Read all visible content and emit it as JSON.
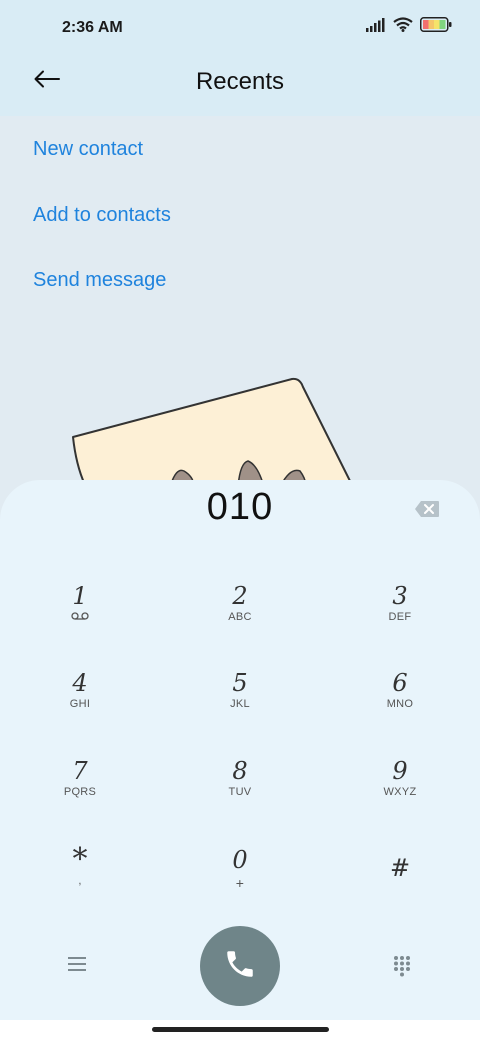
{
  "status_bar": {
    "time": "2:36 AM",
    "icons": [
      "signal-icon",
      "wifi-icon",
      "battery-icon"
    ]
  },
  "header": {
    "back_icon": "back-arrow-icon",
    "title": "Recents"
  },
  "actions": [
    {
      "label": "New contact"
    },
    {
      "label": "Add to contacts"
    },
    {
      "label": "Send message"
    }
  ],
  "dialer": {
    "number": "010",
    "backspace_icon": "backspace-icon",
    "keys": [
      {
        "digit": "1",
        "letters": "voicemail-icon"
      },
      {
        "digit": "2",
        "letters": "ABC"
      },
      {
        "digit": "3",
        "letters": "DEF"
      },
      {
        "digit": "4",
        "letters": "GHI"
      },
      {
        "digit": "5",
        "letters": "JKL"
      },
      {
        "digit": "6",
        "letters": "MNO"
      },
      {
        "digit": "7",
        "letters": "PQRS"
      },
      {
        "digit": "8",
        "letters": "TUV"
      },
      {
        "digit": "9",
        "letters": "WXYZ"
      },
      {
        "digit": "*",
        "letters": ","
      },
      {
        "digit": "0",
        "letters": "+"
      },
      {
        "digit": "#",
        "letters": ""
      }
    ]
  },
  "bottom_bar": {
    "menu_icon": "menu-icon",
    "call_icon": "phone-icon",
    "keypad_icon": "dialpad-icon"
  },
  "colors": {
    "accent": "#1f83dd",
    "call_button": "#6f8589",
    "header_bg": "#d9ecf5",
    "dialer_bg": "#e8f4fb"
  }
}
